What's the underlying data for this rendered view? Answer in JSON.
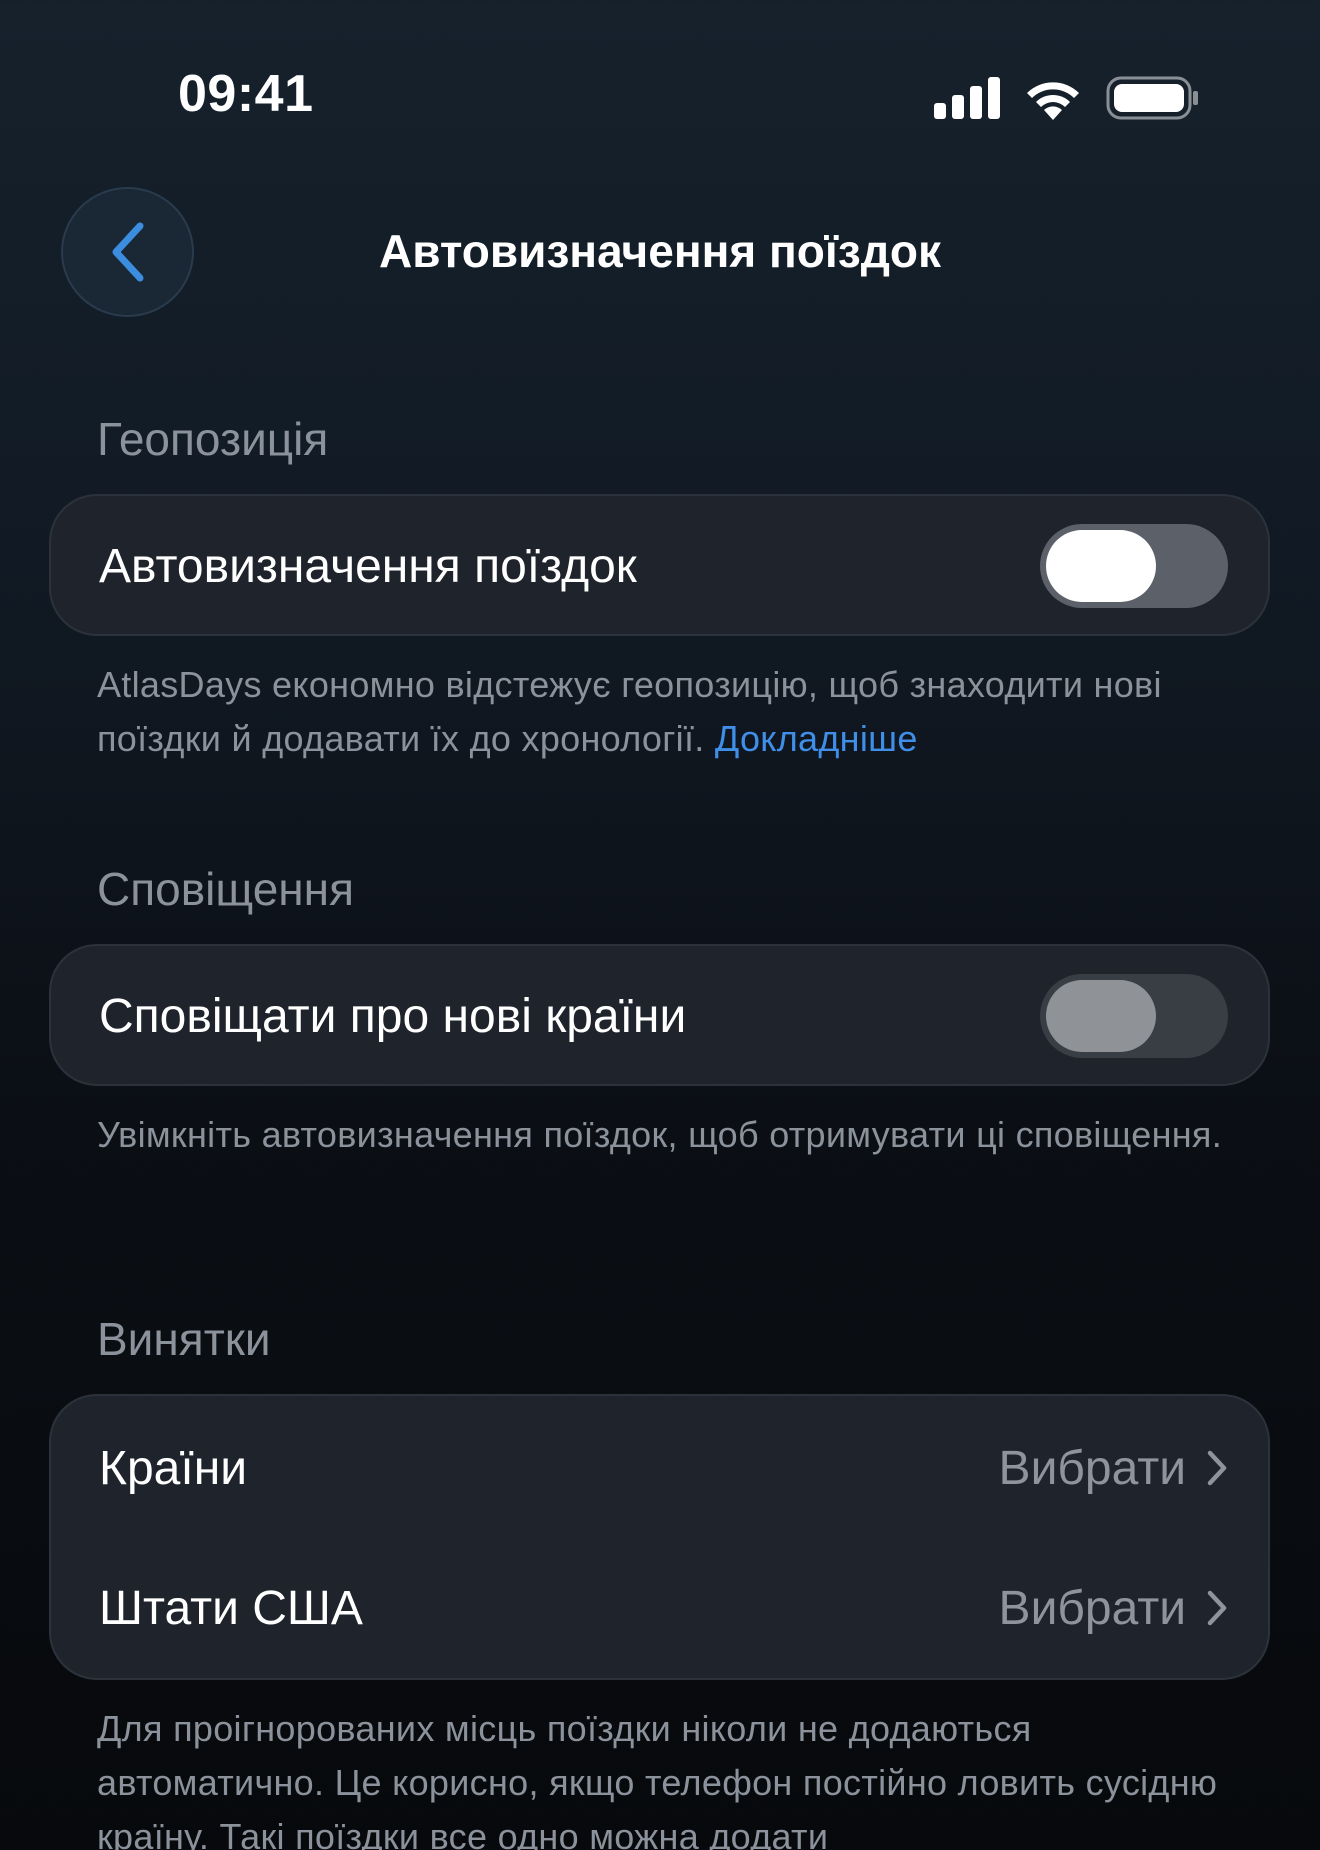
{
  "status_bar": {
    "time": "09:41"
  },
  "nav": {
    "title": "Автовизначення поїздок",
    "back_icon": "chevron-left-icon"
  },
  "sections": {
    "geoposition": {
      "header": "Геопозиція",
      "row_label": "Автовизначення поїздок",
      "toggle_on": false,
      "footnote_text": "AtlasDays економно відстежує геопозицію, щоб знаходити нові поїздки й додавати їх до хронології.",
      "footnote_link": "Докладніше"
    },
    "notifications": {
      "header": "Сповіщення",
      "row_label": "Сповіщати про нові країни",
      "toggle_on": false,
      "toggle_enabled": false,
      "footnote_text": "Увімкніть автовизначення поїздок, щоб отримувати ці сповіщення."
    },
    "exceptions": {
      "header": "Винятки",
      "rows": [
        {
          "label": "Країни",
          "value": "Вибрати"
        },
        {
          "label": "Штати США",
          "value": "Вибрати"
        }
      ],
      "footnote_text": "Для проігнорованих місць поїздки ніколи не додаються автоматично. Це корисно, якщо телефон постійно ловить сусідню країну. Такі поїздки все одно можна додати"
    }
  },
  "colors": {
    "accent_link": "#3f8fe8",
    "back_chevron": "#3b8de0",
    "card_bg": "#1f242c",
    "secondary_text": "#8b929b"
  }
}
